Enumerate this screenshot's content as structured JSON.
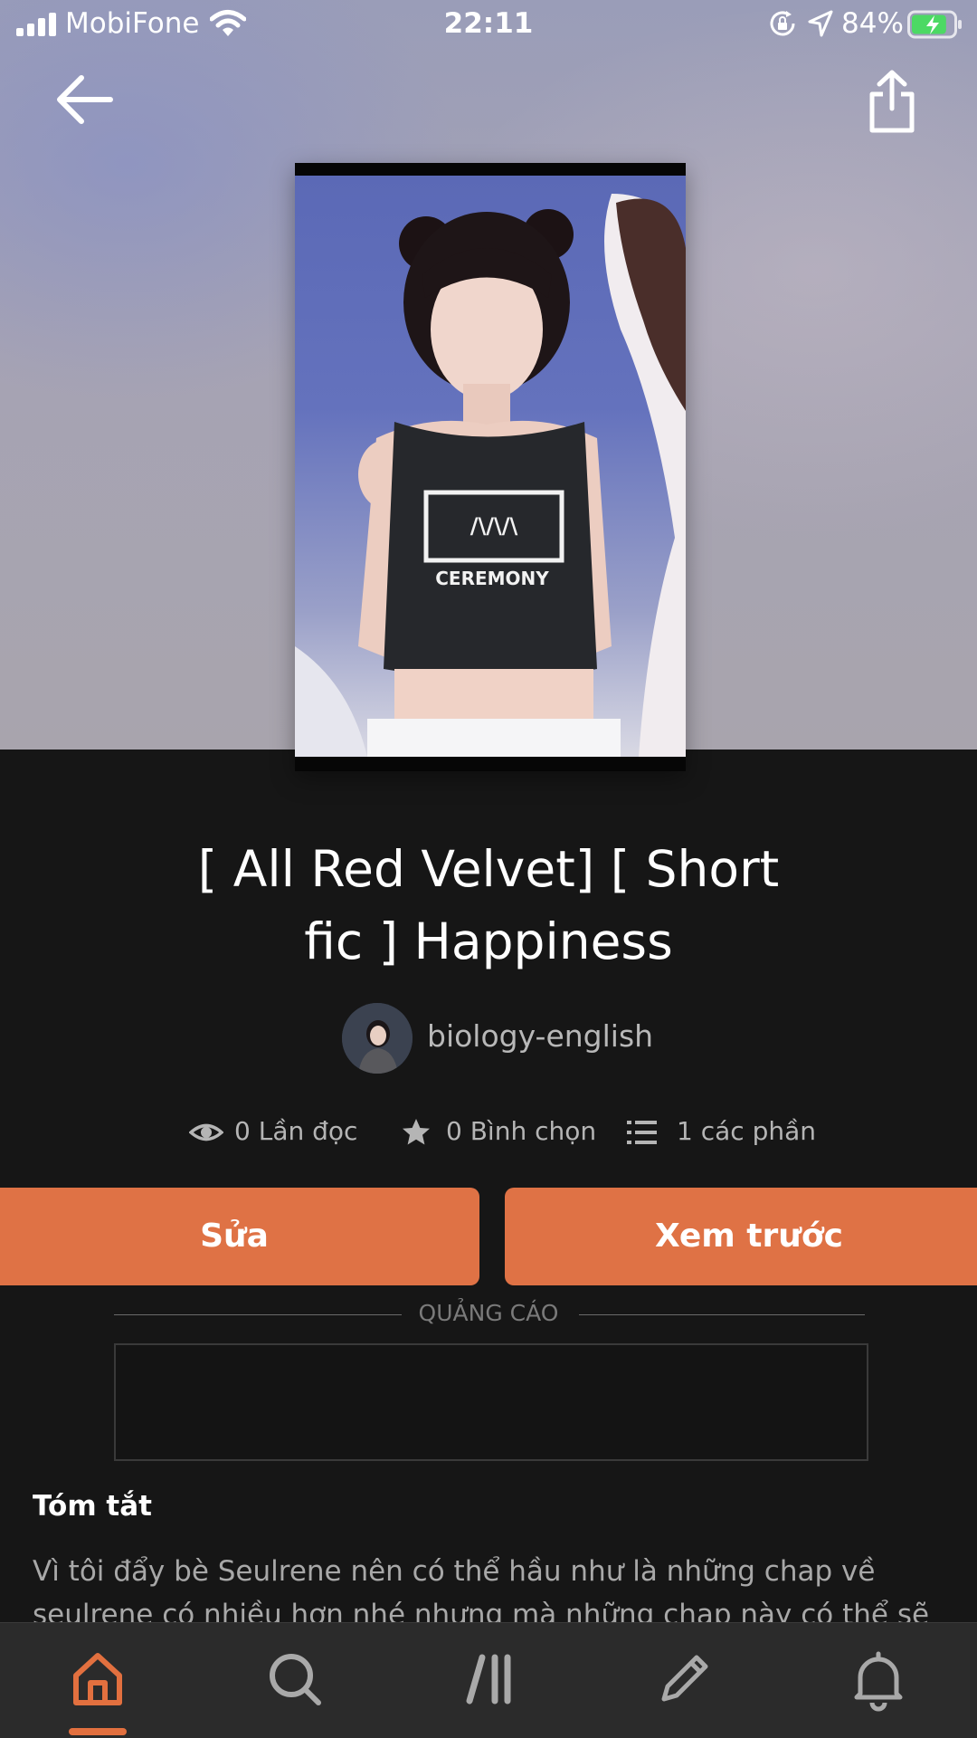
{
  "status_bar": {
    "carrier": "MobiFone",
    "time": "22:11",
    "battery_percent": "84%",
    "battery_level": 0.84
  },
  "story": {
    "title_line1": "[ All Red Velvet] [ Short",
    "title_line2": "fic ] Happiness",
    "author": "biology-english"
  },
  "stats": {
    "reads": "0 Lần đọc",
    "votes": "0 Bình chọn",
    "parts": "1 các phần"
  },
  "actions": {
    "edit_label": "Sửa",
    "preview_label": "Xem trước"
  },
  "ad": {
    "label": "QUẢNG CÁO"
  },
  "summary": {
    "heading": "Tóm tắt",
    "text": "Vì tôi đẩy bè Seulrene nên có thể hầu như là những chap về seulrene có nhiều hơn nhé nhưng mà những chap này có thể sẽ rất"
  },
  "tab_bar": {
    "active": "home",
    "items": [
      "home-icon",
      "search-icon",
      "library-icon",
      "write-icon",
      "notifications-icon"
    ]
  },
  "colors": {
    "accent": "#df7245",
    "background": "#161616",
    "tab_bar": "#2b2b2b"
  }
}
